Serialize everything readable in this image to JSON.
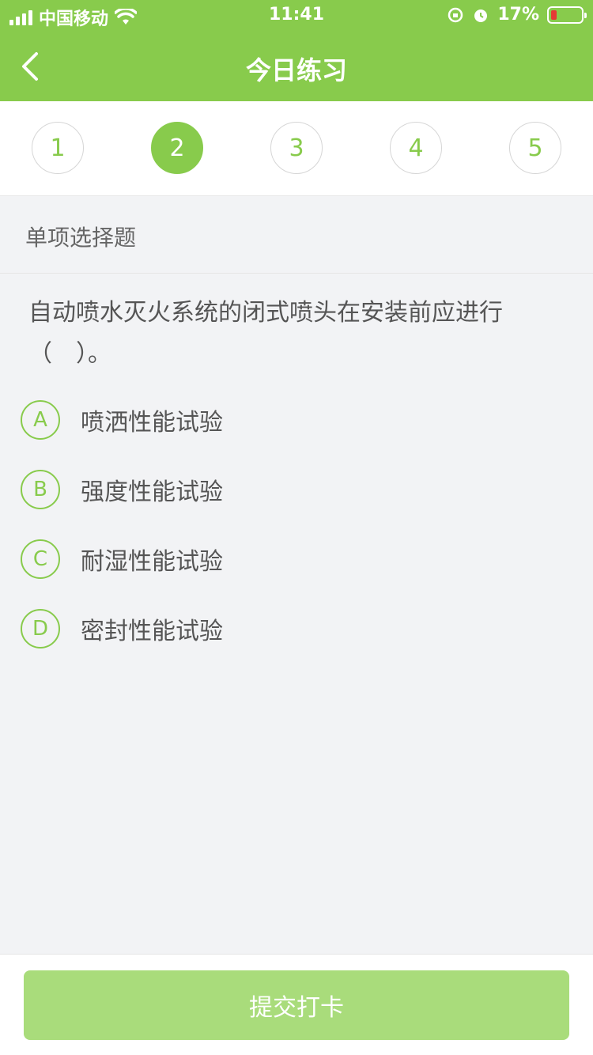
{
  "status_bar": {
    "carrier": "中国移动",
    "time": "11:41",
    "battery": "17%"
  },
  "nav": {
    "title": "今日练习",
    "back_icon": "chevron-left-icon"
  },
  "steps": [
    {
      "label": "1",
      "active": false
    },
    {
      "label": "2",
      "active": true
    },
    {
      "label": "3",
      "active": false
    },
    {
      "label": "4",
      "active": false
    },
    {
      "label": "5",
      "active": false
    }
  ],
  "question": {
    "type": "单项选择题",
    "text": "自动喷水灭火系统的闭式喷头在安装前应进行（　）。",
    "options": [
      {
        "key": "A",
        "text": "喷洒性能试验"
      },
      {
        "key": "B",
        "text": "强度性能试验"
      },
      {
        "key": "C",
        "text": "耐湿性能试验"
      },
      {
        "key": "D",
        "text": "密封性能试验"
      }
    ]
  },
  "footer": {
    "submit_label": "提交打卡"
  },
  "colors": {
    "brand": "#88cb4c",
    "submit_disabled": "#a9dc7b"
  }
}
